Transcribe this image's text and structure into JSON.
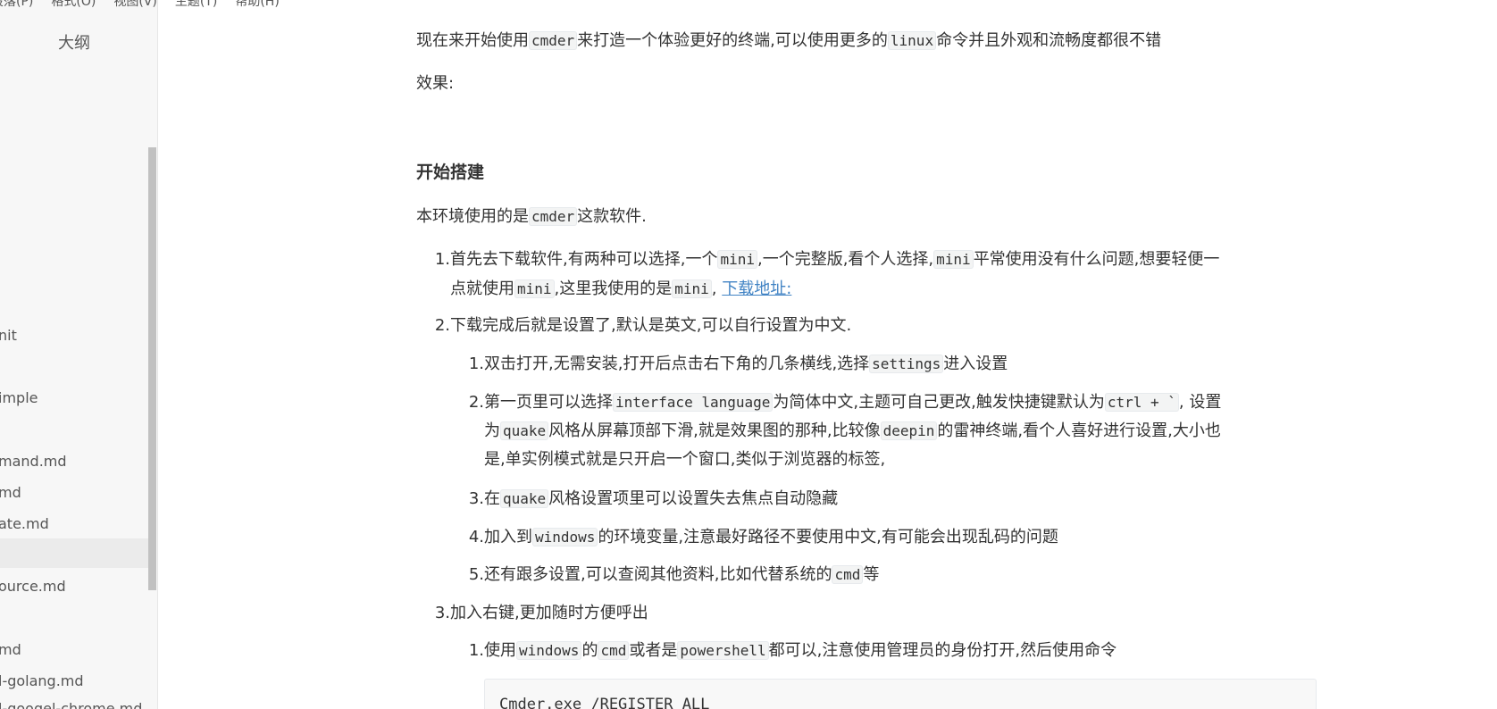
{
  "menubar": {
    "items": [
      "段落(P)",
      "格式(O)",
      "视图(V)",
      "主题(T)",
      "帮助(H)"
    ]
  },
  "sidebar": {
    "title": "大纲",
    "files": [
      {
        "label": "nit"
      },
      {
        "label": "imple"
      },
      {
        "label": "mand.md"
      },
      {
        "label": "md"
      },
      {
        "label": "ate.md"
      },
      {
        "label": "ource.md"
      },
      {
        "label": "md"
      },
      {
        "label": "l-golang.md"
      },
      {
        "label": "l-googel-chrome.md"
      }
    ]
  },
  "content": {
    "intro": {
      "a": "现在来开始使用",
      "code1": "cmder",
      "b": "来打造一个体验更好的终端,可以使用更多的",
      "code2": "linux",
      "c": "命令并且外观和流畅度都很不错"
    },
    "effect_label": "效果:",
    "heading": "开始搭建",
    "env": {
      "a": "本环境使用的是",
      "code": "cmder",
      "b": "这款软件."
    },
    "list": {
      "item1": {
        "num": "1.",
        "a": "首先去下载软件,有两种可以选择,一个",
        "code1": "mini",
        "b": ",一个完整版,看个人选择,",
        "code2": "mini",
        "c": "平常使用没有什么问题,想要轻便一",
        "d": "点就使用",
        "code3": "mini",
        "e": ",这里我使用的是",
        "code4": "mini",
        "f": ",",
        "link": "下载地址:"
      },
      "item2": {
        "num": "2.",
        "text": "下载完成后就是设置了,默认是英文,可以自行设置为中文.",
        "sub": {
          "s1": {
            "num": "1.",
            "a": "双击打开,无需安装,打开后点击右下角的几条横线,选择",
            "code": "settings",
            "b": "进入设置"
          },
          "s2": {
            "num": "2.",
            "a": "第一页里可以选择",
            "code1": "interface language",
            "b": "为简体中文,主题可自己更改,触发快捷键默认为",
            "code2": "ctrl + `",
            "c": ", 设置",
            "d": "为",
            "code3": "quake",
            "e": "风格从屏幕顶部下滑,就是效果图的那种,比较像",
            "code4": "deepin",
            "f": "的雷神终端,看个人喜好进行设置,大小也",
            "g": "是,单实例模式就是只开启一个窗口,类似于浏览器的标签,"
          },
          "s3": {
            "num": "3.",
            "a": "在",
            "code": "quake",
            "b": "风格设置项里可以设置失去焦点自动隐藏"
          },
          "s4": {
            "num": "4.",
            "a": "加入到",
            "code": "windows",
            "b": "的环境变量,注意最好路径不要使用中文,有可能会出现乱码的问题"
          },
          "s5": {
            "num": "5.",
            "a": "还有跟多设置,可以查阅其他资料,比如代替系统的",
            "code": "cmd",
            "b": "等"
          }
        }
      },
      "item3": {
        "num": "3.",
        "text": "加入右键,更加随时方便呼出",
        "sub": {
          "s1": {
            "num": "1.",
            "a": "使用",
            "code1": "windows",
            "b": "的",
            "code2": "cmd",
            "c": "或者是",
            "code3": "powershell",
            "d": "都可以,注意使用管理员的身份打开,然后使用命令"
          }
        }
      }
    },
    "codeblock": {
      "line": "Cmder.exe /REGISTER ALL"
    }
  }
}
